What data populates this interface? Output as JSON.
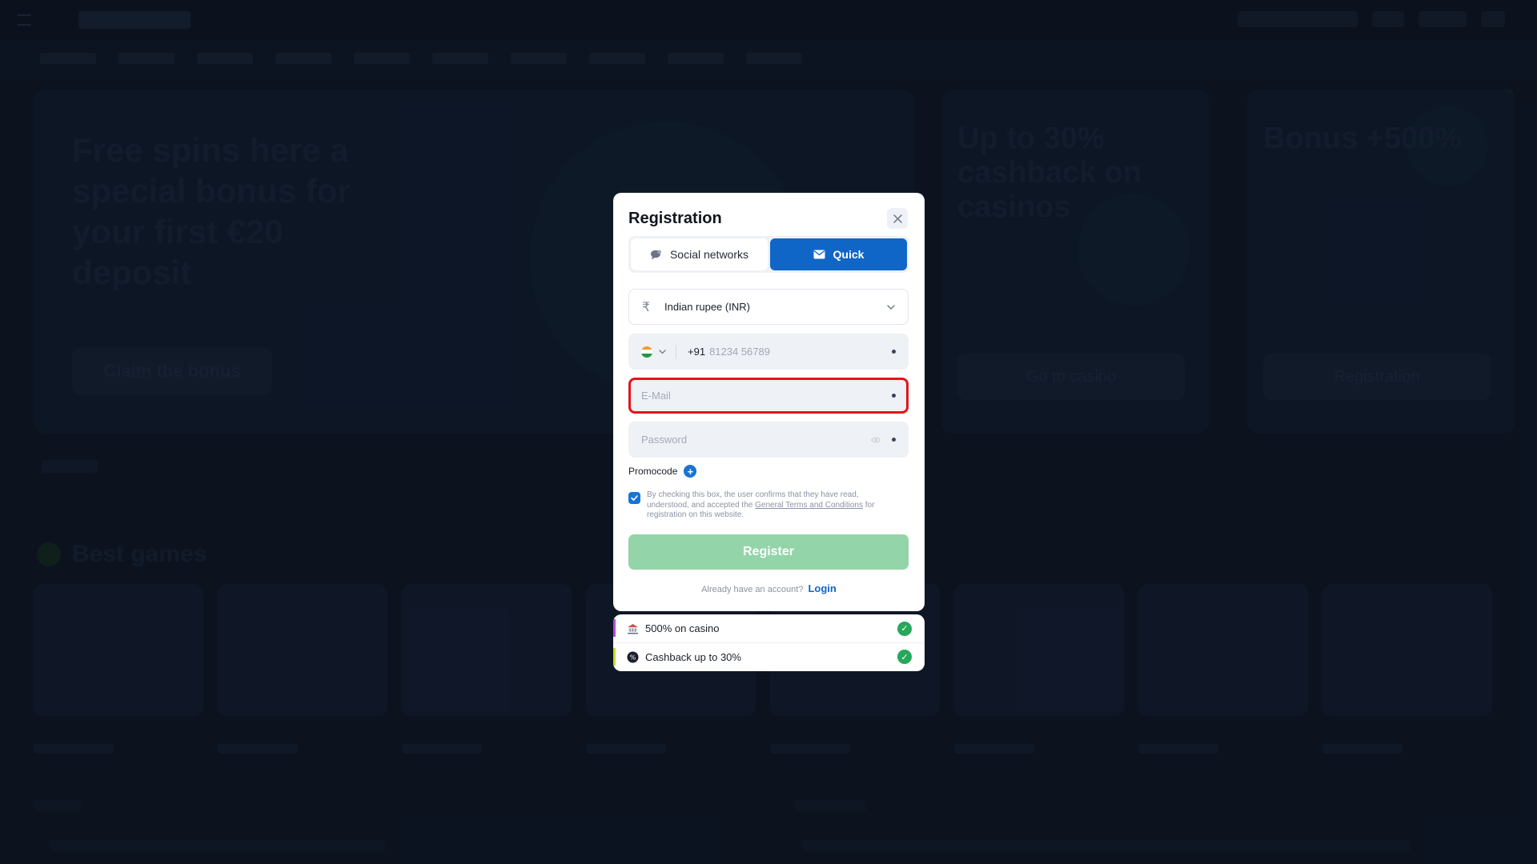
{
  "background": {
    "hero_title": "Free spins here a special bonus for your first €20 deposit",
    "hero_button": "Claim the bonus",
    "promo_1_title": "Up to 30% cashback on casinos",
    "promo_1_button": "Go to casino",
    "promo_2_title": "Bonus +500%",
    "promo_2_button": "Registration",
    "best_games_label": "Best games"
  },
  "modal": {
    "title": "Registration",
    "tabs": [
      {
        "label": "Social networks",
        "icon": "chat-icon",
        "active": false
      },
      {
        "label": "Quick",
        "icon": "envelope-icon",
        "active": true
      }
    ],
    "currency": {
      "symbol": "₹",
      "value": "Indian rupee (INR)"
    },
    "phone": {
      "country": "India",
      "code": "+91",
      "placeholder": "81234 56789"
    },
    "email": {
      "placeholder": "E-Mail"
    },
    "password": {
      "placeholder": "Password"
    },
    "promocode_label": "Promocode",
    "terms": {
      "text_before": "By checking this box, the user confirms that they have read, understood, and accepted the ",
      "link": "General Terms and Conditions",
      "text_after": " for registration on this website.",
      "checked": true
    },
    "register_label": "Register",
    "login_prompt": "Already have an account?",
    "login_label": "Login"
  },
  "bonuses": [
    {
      "label": "500% on casino",
      "icon": "casino-icon",
      "stripe": "#b64bd8"
    },
    {
      "label": "Cashback up to 30%",
      "icon": "cashback-icon",
      "stripe": "#c6df2b"
    }
  ],
  "colors": {
    "primary": "#1066c6",
    "register_disabled": "#93d4a8",
    "highlight": "#e3141b",
    "success": "#27a85a"
  }
}
